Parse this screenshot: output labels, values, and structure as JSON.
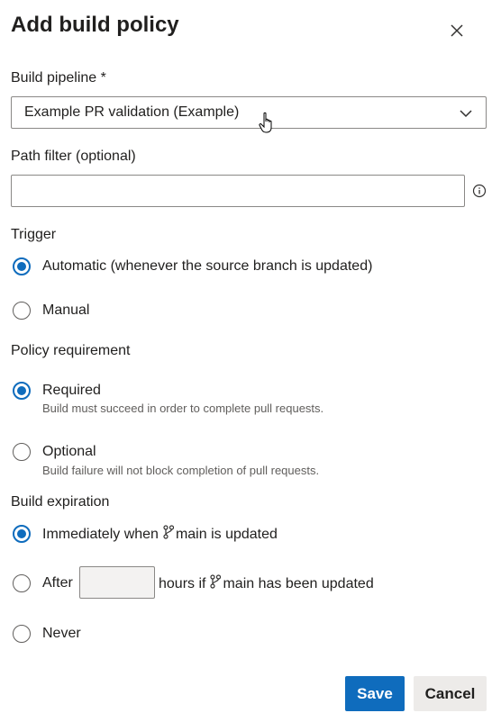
{
  "dialog": {
    "title": "Add build policy"
  },
  "build_pipeline": {
    "label": "Build pipeline *",
    "selected": "Example PR validation (Example)"
  },
  "path_filter": {
    "label": "Path filter (optional)",
    "value": "",
    "placeholder": ""
  },
  "trigger": {
    "label": "Trigger",
    "options": [
      {
        "label": "Automatic (whenever the source branch is updated)",
        "checked": true
      },
      {
        "label": "Manual",
        "checked": false
      }
    ]
  },
  "policy_requirement": {
    "label": "Policy requirement",
    "options": [
      {
        "label": "Required",
        "description": "Build must succeed in order to complete pull requests.",
        "checked": true
      },
      {
        "label": "Optional",
        "description": "Build failure will not block completion of pull requests.",
        "checked": false
      }
    ]
  },
  "build_expiration": {
    "label": "Build expiration",
    "immediately_prefix": "Immediately when",
    "immediately_suffix": "main is updated",
    "after_prefix": "After",
    "after_middle": "hours if",
    "after_suffix": "main has been updated",
    "hours_value": "",
    "never": "Never",
    "selected": "immediately"
  },
  "buttons": {
    "save": "Save",
    "cancel": "Cancel"
  },
  "colors": {
    "accent": "#0f6cbd"
  },
  "icons": {
    "close": "close-icon",
    "dropdown": "chevron-down-icon",
    "info": "info-icon",
    "branch": "branch-icon",
    "cursor": "hand-pointer-icon"
  }
}
